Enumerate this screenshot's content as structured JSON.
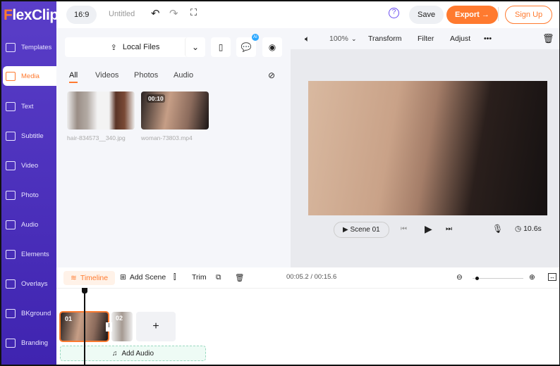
{
  "app": {
    "logo": "FlexClip",
    "accent": "#ff7a2f",
    "sidebar_color": "#4b30bc"
  },
  "topbar": {
    "ratio": "16:9",
    "title": "Untitled",
    "save": "Save",
    "export": "Export →",
    "signup": "Sign Up"
  },
  "sidebar": {
    "items": [
      {
        "label": "Templates",
        "icon": "layers-icon"
      },
      {
        "label": "Media",
        "icon": "folder-plus-icon"
      },
      {
        "label": "Text",
        "icon": "text-icon"
      },
      {
        "label": "Subtitle",
        "icon": "subtitle-icon"
      },
      {
        "label": "Video",
        "icon": "video-icon"
      },
      {
        "label": "Photo",
        "icon": "photo-icon"
      },
      {
        "label": "Audio",
        "icon": "music-icon"
      },
      {
        "label": "Elements",
        "icon": "elements-icon"
      },
      {
        "label": "Overlays",
        "icon": "overlays-icon"
      },
      {
        "label": "BKground",
        "icon": "background-icon"
      },
      {
        "label": "Branding",
        "icon": "stamp-icon"
      }
    ],
    "active": "Media"
  },
  "media": {
    "local_files": "Local Files",
    "ai_badge": "AI",
    "tabs": [
      "All",
      "Videos",
      "Photos",
      "Audio"
    ],
    "files": [
      {
        "name": "hair-834573__340.jpg"
      },
      {
        "name": "woman-73803.mp4",
        "duration": "00:10"
      }
    ]
  },
  "preview": {
    "zoom": "100%",
    "transform": "Transform",
    "filter": "Filter",
    "adjust": "Adjust",
    "more": "•••",
    "scene": "Scene 01",
    "duration": "10.6s"
  },
  "timeline": {
    "label": "Timeline",
    "add_scene": "Add Scene",
    "trim": "Trim",
    "time": "00:05.2 / 00:15.6",
    "scenes": [
      "01",
      "02"
    ],
    "add": "+",
    "add_audio": "Add Audio",
    "zoom_level": 0.05
  }
}
